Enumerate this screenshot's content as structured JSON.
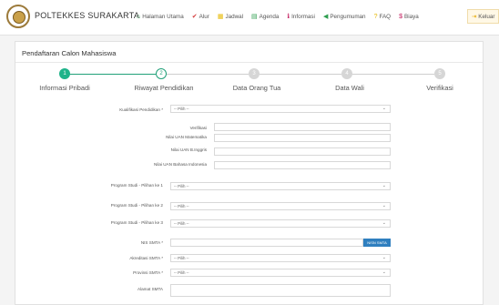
{
  "brand": "POLTEKKES SURAKARTA",
  "nav": [
    {
      "label": "Halaman Utama",
      "icon": "home-icon",
      "glyph": "⌂",
      "color": "#2e9e4f"
    },
    {
      "label": "Alur",
      "icon": "check-icon",
      "glyph": "✔",
      "color": "#d43b3b"
    },
    {
      "label": "Jadwal",
      "icon": "calendar-icon",
      "glyph": "▦",
      "color": "#e6b800"
    },
    {
      "label": "Agenda",
      "icon": "agenda-icon",
      "glyph": "▤",
      "color": "#2e9e4f"
    },
    {
      "label": "Informasi",
      "icon": "info-icon",
      "glyph": "ℹ",
      "color": "#c2185b"
    },
    {
      "label": "Pengumuman",
      "icon": "megaphone-icon",
      "glyph": "◀",
      "color": "#2e9e4f"
    },
    {
      "label": "FAQ",
      "icon": "faq-icon",
      "glyph": "?",
      "color": "#e6b800"
    },
    {
      "label": "Biaya",
      "icon": "dollar-icon",
      "glyph": "$",
      "color": "#c2185b"
    }
  ],
  "logout": {
    "label": "Keluar",
    "icon": "logout-icon",
    "glyph": "⇥",
    "color": "#e6a800"
  },
  "card_title": "Pendaftaran Calon Mahasiswa",
  "steps": [
    {
      "num": "1",
      "label": "Informasi Pribadi",
      "state": "done"
    },
    {
      "num": "2",
      "label": "Riwayat Pendidikan",
      "state": "active"
    },
    {
      "num": "3",
      "label": "Data Orang Tua",
      "state": "todo"
    },
    {
      "num": "4",
      "label": "Data Wali",
      "state": "todo"
    },
    {
      "num": "5",
      "label": "Verifikasi",
      "state": "todo"
    }
  ],
  "form": {
    "kualifikasi": {
      "label": "Kualifikasi Pendidikan *",
      "value": "-- Pilih --"
    },
    "verifikasi_label": "Verifikasi",
    "nilai_uan_mtk": "Nilai UAN Matematika",
    "nilai_uan_ing": "Nilai UAN B.Inggris",
    "nilai_uan_ind": "Nilai UAN Bahasa Indonesia",
    "prodi1": {
      "label": "Program Studi - Pilihan ke 1",
      "value": "-- Pilih --"
    },
    "prodi2": {
      "label": "Program Studi - Pilihan ke 2",
      "value": "-- Pilih --"
    },
    "prodi3": {
      "label": "Program Studi - Pilihan ke 3",
      "value": "-- Pilih --"
    },
    "nis": {
      "label": "NIS SMTA *",
      "button": "NISN SMTA"
    },
    "akreditasi": {
      "label": "Akreditasi SMTA *",
      "value": "-- Pilih --"
    },
    "provinsi": {
      "label": "Provinsi SMTA *",
      "value": "-- Pilih --"
    },
    "alamat": {
      "label": "Alamat SMTA"
    }
  }
}
